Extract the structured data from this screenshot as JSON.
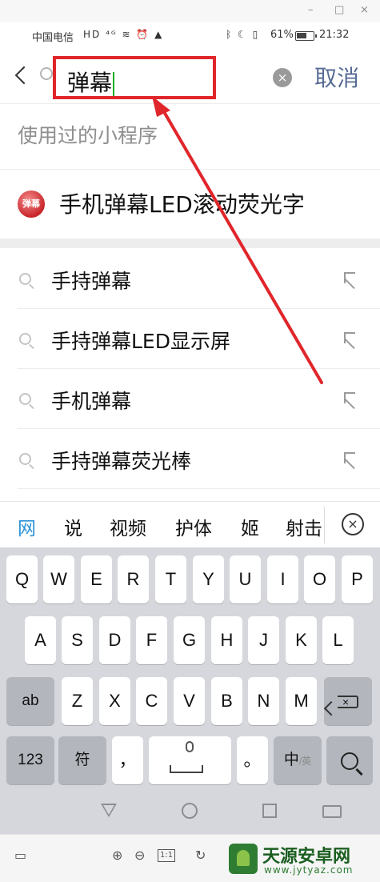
{
  "window": {
    "minimize": "–",
    "maximize": "□",
    "close": "×"
  },
  "status_bar": {
    "carrier": "中国电信",
    "left_icons": "HD ⁴ᴳ ≋ ⏰ ▲",
    "right_icons": "ᛒ ☾ ▯",
    "battery_percent": "61%",
    "battery_level": 0.61,
    "time": "21:32"
  },
  "search": {
    "query": "弹幕",
    "clear_symbol": "×",
    "cancel_label": "取消"
  },
  "used_programs": {
    "title": "使用过的小程序",
    "items": [
      {
        "name": "手机弹幕LED滚动荧光字",
        "avatar_text": "弹幕"
      }
    ]
  },
  "suggestions": [
    {
      "text": "手持弹幕"
    },
    {
      "text": "手持弹幕LED显示屏"
    },
    {
      "text": "手机弹幕"
    },
    {
      "text": "手持弹幕荧光棒"
    }
  ],
  "candidates": {
    "items": [
      "网",
      "说",
      "视频",
      "护体",
      "姬",
      "射击"
    ],
    "close_symbol": "×"
  },
  "keyboard": {
    "row1": [
      "Q",
      "W",
      "E",
      "R",
      "T",
      "Y",
      "U",
      "I",
      "O",
      "P"
    ],
    "row2": [
      "A",
      "S",
      "D",
      "F",
      "G",
      "H",
      "J",
      "K",
      "L"
    ],
    "row3_letters": [
      "Z",
      "X",
      "C",
      "V",
      "B",
      "N",
      "M"
    ],
    "shift_label": "ab",
    "backspace_symbol": "×",
    "num_label": "123",
    "symbol_label": "符",
    "comma_label": "，",
    "period_label": "。",
    "lang_label": "中",
    "lang_sub": "/英"
  },
  "emulator_toolbar": {
    "zoom_in": "⊕",
    "zoom_out": "⊖",
    "actual_size": "1:1",
    "rotate": "↻"
  },
  "watermark": {
    "title": "天源安卓网",
    "url": "www.jytyaz.com"
  },
  "colors": {
    "highlight_box": "#e0262b",
    "cancel_link": "#576b95",
    "caret": "#1aad19",
    "candidate_active": "#2b93d9",
    "arrow": "#e0262b"
  }
}
